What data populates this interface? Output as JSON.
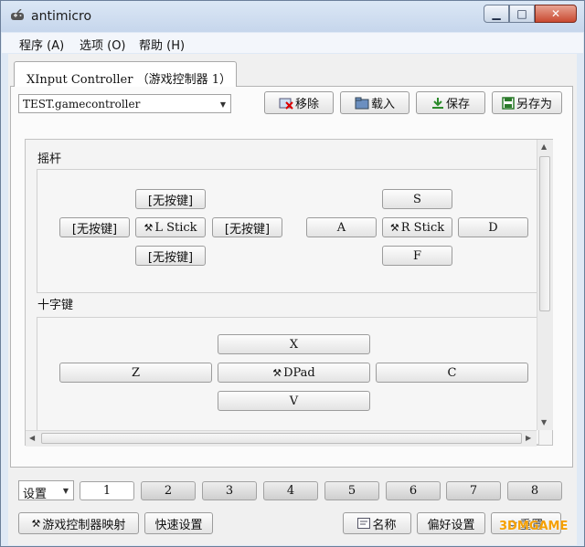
{
  "window": {
    "title": "antimicro",
    "controls": {
      "minimize": "▁",
      "maximize": "□",
      "close": "✕"
    }
  },
  "menu": [
    "程序 (A)",
    "选项 (O)",
    "帮助 (H)"
  ],
  "tab": {
    "label": "XInput Controller （游戏控制器 1）"
  },
  "profile": {
    "selected": "TEST.gamecontroller"
  },
  "toolbar": {
    "remove": "移除",
    "load": "载入",
    "save": "保存",
    "save_as": "另存为"
  },
  "sticks": {
    "title": "摇杆",
    "left": {
      "up": "[无按键]",
      "left": "[无按键]",
      "center": "L Stick",
      "right": "[无按键]",
      "down": "[无按键]"
    },
    "right": {
      "up": "S",
      "left": "A",
      "center": "R Stick",
      "right": "D",
      "down": "F"
    }
  },
  "dpad": {
    "title": "十字键",
    "up": "X",
    "left": "Z",
    "center": "DPad",
    "right": "C",
    "down": "V"
  },
  "sets": {
    "dropdown": "设置",
    "items": [
      "1",
      "2",
      "3",
      "4",
      "5",
      "6",
      "7",
      "8"
    ],
    "active_index": 0
  },
  "bottom": {
    "mapping": "游戏控制器映射",
    "quick_setup": "快速设置",
    "name": "名称",
    "preferences": "偏好设置",
    "reset": "重置"
  },
  "watermark": "3DMGAME",
  "colors": {
    "titlebar": "#c6d6ec",
    "close_button": "#c94a31",
    "watermark": "#f5a000"
  }
}
